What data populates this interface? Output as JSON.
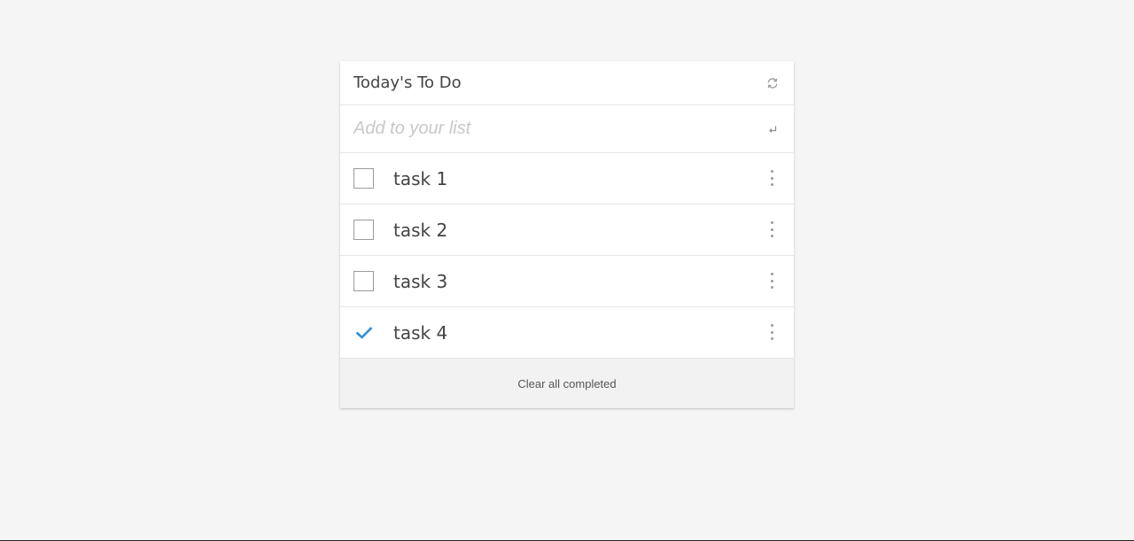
{
  "header": {
    "title": "Today's To Do",
    "refresh_icon": "refresh-icon"
  },
  "add": {
    "placeholder": "Add to your list",
    "value": "",
    "enter_icon": "enter-return-icon"
  },
  "tasks": [
    {
      "label": "task 1",
      "completed": false
    },
    {
      "label": "task 2",
      "completed": false
    },
    {
      "label": "task 3",
      "completed": false
    },
    {
      "label": "task 4",
      "completed": true
    }
  ],
  "footer": {
    "clear_label": "Clear all completed"
  },
  "colors": {
    "background": "#f5f5f5",
    "card": "#ffffff",
    "accent_check": "#2f8fd8",
    "text": "#444444",
    "placeholder": "#c8c8c8"
  }
}
